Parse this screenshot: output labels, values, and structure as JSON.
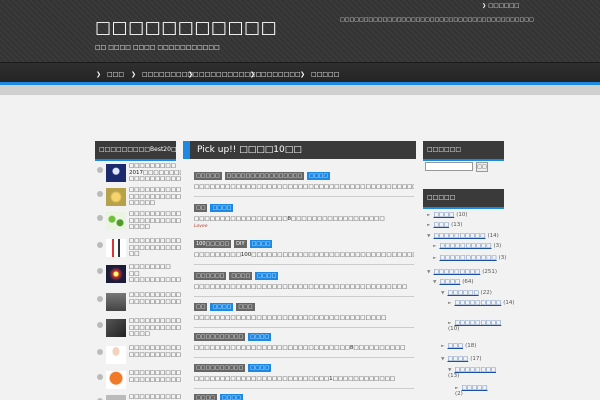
{
  "header": {
    "site_title": "□□□□□□□□□□□",
    "site_description": "□□ □□□□ □□□□ □□□□□□□□□□□",
    "tagline": "□□□□□□□□□□□□□□□□□□□□□□□□□□□□□□□□□□□□□□□□□",
    "top_link": "□□□□□□"
  },
  "nav": {
    "items": [
      {
        "label": "□□□"
      },
      {
        "label": "□□□□□□□□□□"
      },
      {
        "label": "□□□□□□□□□□□"
      },
      {
        "label": "□□□□□□□"
      },
      {
        "label": "□□□□□"
      }
    ]
  },
  "colors": {
    "accent": "#1e88e5",
    "header_bg": "#333333",
    "panel_bg": "#3a3a3a",
    "page_bg": "#f2f2f2"
  },
  "ranking": {
    "title": "□□□□□□□□□Best20□",
    "items": [
      {
        "title": "□□□□□□□□□ 2017□□□□□□□□□□ □□□□□□□□□□□"
      },
      {
        "title": "□□□□□□□□□□□ □□□□□□□□□□□□ □□□□□"
      },
      {
        "title": "□□□□□□□□□□□ □□□□□□□□□□□□ □□□□"
      },
      {
        "title": "□□□□□□□□□□□ □□□□□□□□□□□□ □□"
      },
      {
        "title": "□□□□□□□□ □□ □□□□□□□□□□□□ □□□□□□□"
      },
      {
        "title": "□□□□□□□□□□□ □□□□□□□□□□□□"
      },
      {
        "title": "□□□□□□□□□□□ □□□□□□□□□□□□ □□□□"
      },
      {
        "title": "□□□□□□□□□□□ □□□□□□□□□□□□"
      },
      {
        "title": "□□□□□□□□□□□ □□□□□□□□□□□□"
      },
      {
        "title": "□□□□□□□□□□□ □□□□□□□□"
      }
    ]
  },
  "pickup": {
    "title": "Pick up!! □□□□10□□",
    "entries": [
      {
        "tags": [
          {
            "text": "□□□□□",
            "blue": false
          },
          {
            "text": "□□□□□□□□□□□□□□□□",
            "blue": false
          },
          {
            "text": "□□□□",
            "blue": true
          }
        ],
        "title": "□□□□□□□□□□□□□□□□□□□□□□□□□□□□□□□□□□□□□□□□□□□□",
        "sub": ""
      },
      {
        "tags": [
          {
            "text": "□□",
            "blue": false
          },
          {
            "text": "□□□□",
            "blue": true
          }
        ],
        "title": "□□□□□□□□□□□□□□□□□□8□□□□□□□□□□□□□□□□□□",
        "sub": "Lovee"
      },
      {
        "tags": [
          {
            "text": "100□□□□□",
            "blue": false
          },
          {
            "text": "DIY",
            "blue": false
          },
          {
            "text": "□□□□",
            "blue": true
          }
        ],
        "title": "□□□□□□□□□100□□□□□□□□□□□□□□□□□□□□□□□□□□□□□□□□□",
        "sub": ""
      },
      {
        "tags": [
          {
            "text": "□□□□□□",
            "blue": false
          },
          {
            "text": "□□□□",
            "blue": false
          },
          {
            "text": "□□□□",
            "blue": true
          }
        ],
        "title": "□□□□□□□□□□□□□□□□□□□□□□□□□□□□□□□□□□□□□□□□□",
        "sub": ""
      },
      {
        "tags": [
          {
            "text": "□□",
            "blue": false
          },
          {
            "text": "□□□□",
            "blue": true
          },
          {
            "text": "□□□",
            "blue": false
          }
        ],
        "title": "□□□□□□□□□□□□□□□□□□□□□□□□□□□□□□□□□□□□□",
        "sub": ""
      },
      {
        "tags": [
          {
            "text": "□□□□□□□□□□",
            "blue": false
          },
          {
            "text": "□□□□",
            "blue": true
          }
        ],
        "title": "□□□□□□□□□□□□□□□□□□□□□□□□□□□□□□8□□□□□□□□□□",
        "sub": ""
      },
      {
        "tags": [
          {
            "text": "□□□□□□□□□□",
            "blue": false
          },
          {
            "text": "□□□□",
            "blue": true
          }
        ],
        "title": "□□□□□□□□□□□□□□□□□□□□□□□□□□1□□□□□□□□□□□□",
        "sub": ""
      }
    ],
    "last_tags": [
      {
        "text": "□□□□",
        "blue": false
      },
      {
        "text": "□□□□",
        "blue": true
      }
    ]
  },
  "search": {
    "title": "□□□□□□",
    "button": "□□"
  },
  "categories": {
    "title": "□□□□□",
    "items": [
      {
        "name": "□□□□",
        "count": "(10)"
      },
      {
        "name": "□□□",
        "count": "(13)"
      },
      {
        "name": "□□□□□□□□□□",
        "count": "(14)"
      },
      {
        "name": "□□□□□□□□□□",
        "count": "(3)"
      },
      {
        "name": "□□□□□□□□□□□",
        "count": "(3)"
      },
      {
        "name": "□□□□□□□□□",
        "count": "(251)"
      },
      {
        "name": "□□□□",
        "count": "(64)"
      },
      {
        "name": "□□□□□□",
        "count": "(22)"
      },
      {
        "name": "□□□□□□□□□",
        "count": "(14)"
      },
      {
        "name": "□□□□□□□□□",
        "count": "(10)"
      },
      {
        "name": "□□□",
        "count": "(18)"
      },
      {
        "name": "□□□□",
        "count": "(17)"
      },
      {
        "name": "□□□□□□□□",
        "count": "(13)"
      },
      {
        "name": "□□□□□",
        "count": "(2)"
      }
    ]
  }
}
